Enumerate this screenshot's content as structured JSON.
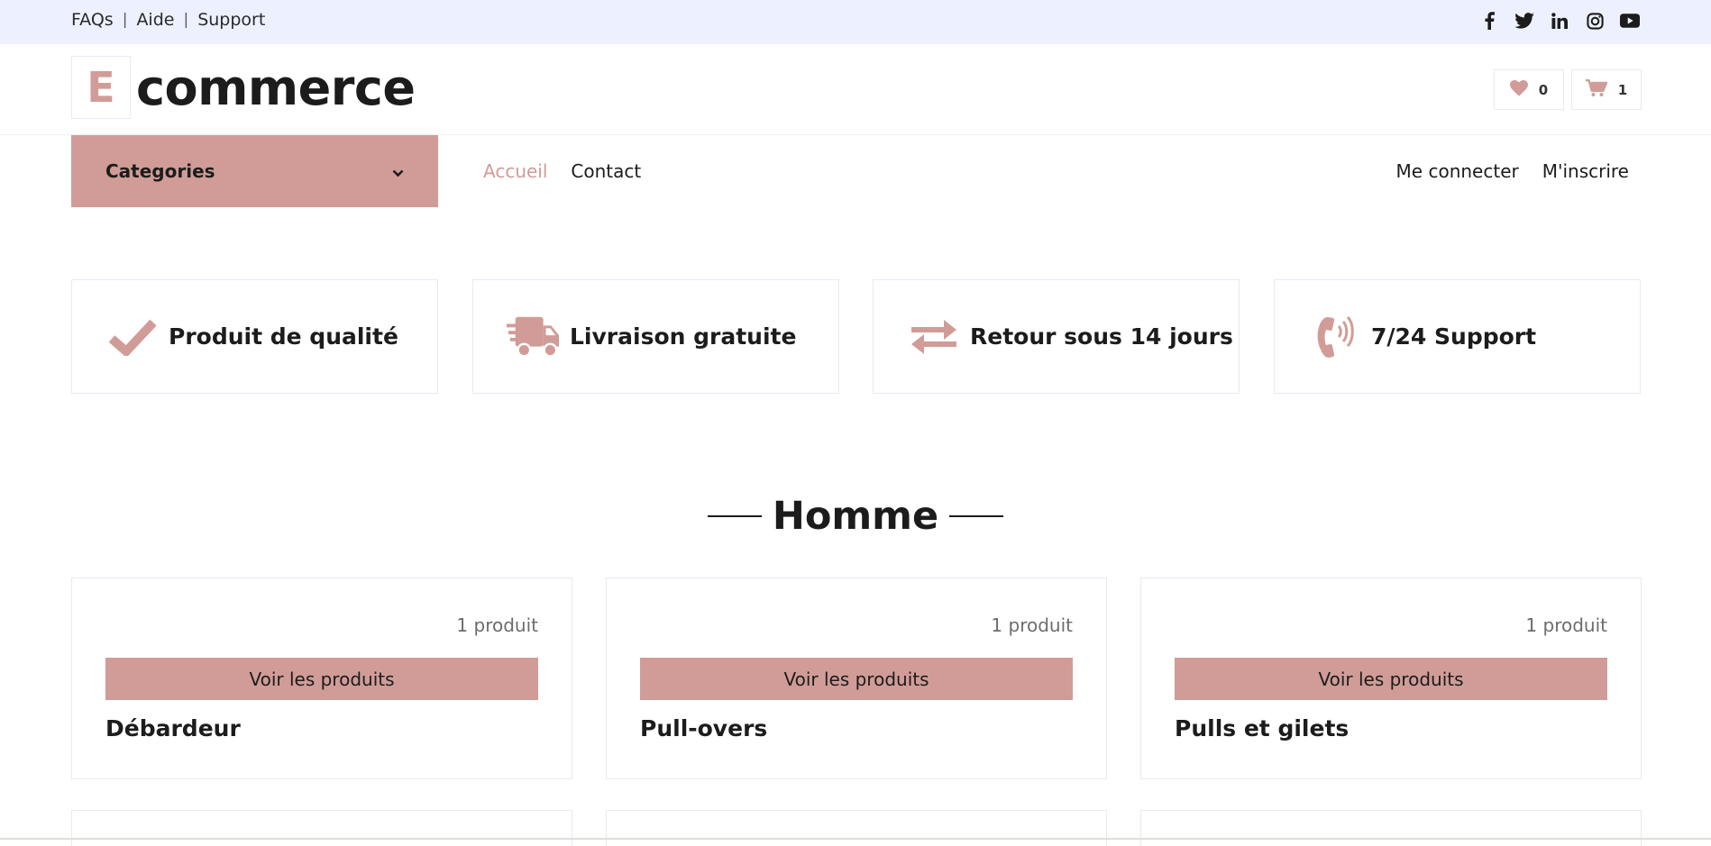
{
  "topbar": {
    "links": [
      "FAQs",
      "Aide",
      "Support"
    ],
    "separator": "|",
    "social_icons": [
      "facebook-icon",
      "twitter-icon",
      "linkedin-icon",
      "instagram-icon",
      "youtube-icon"
    ]
  },
  "header": {
    "logo_letter": "E",
    "logo_text": "commerce",
    "wishlist_count": "0",
    "cart_count": "1"
  },
  "nav": {
    "categories_label": "Categories",
    "links": [
      {
        "label": "Accueil",
        "active": true
      },
      {
        "label": "Contact",
        "active": false
      }
    ],
    "auth": [
      "Me connecter",
      "M'inscrire"
    ]
  },
  "features": [
    {
      "icon": "check-icon",
      "label": "Produit de qualité"
    },
    {
      "icon": "shipping-truck-icon",
      "label": "Livraison gratuite"
    },
    {
      "icon": "exchange-arrows-icon",
      "label": "Retour sous 14 jours"
    },
    {
      "icon": "phone-volume-icon",
      "label": "7/24 Support"
    }
  ],
  "section": {
    "title": "Homme",
    "cards": [
      {
        "count": "1 produit",
        "button": "Voir les produits",
        "name": "Débardeur"
      },
      {
        "count": "1 produit",
        "button": "Voir les produits",
        "name": "Pull-overs"
      },
      {
        "count": "1 produit",
        "button": "Voir les produits",
        "name": "Pulls et gilets"
      }
    ]
  },
  "colors": {
    "accent": "#d19c97",
    "topbar_bg": "#edf1ff",
    "text": "#1c1c1c",
    "border": "#e8eaf3"
  }
}
